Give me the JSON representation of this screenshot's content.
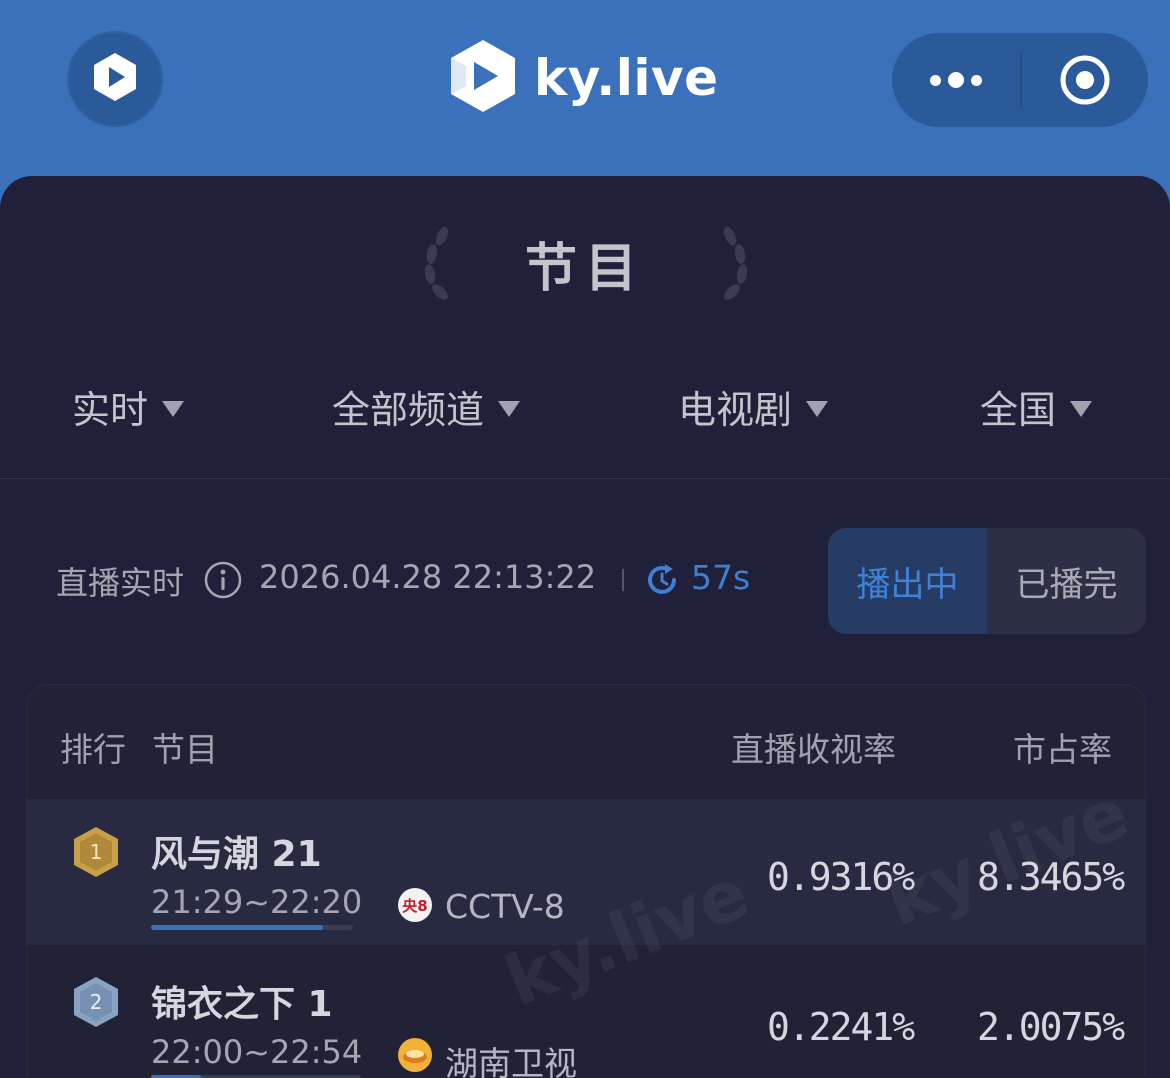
{
  "header": {
    "brand": "ky.live",
    "app_icon": "kylive-logo-icon",
    "more_icon": "more-dots-icon",
    "close_icon": "target-circle-icon",
    "colors": {
      "bar": "#3a71ba",
      "capsule": "#2b5a9a"
    }
  },
  "page": {
    "title": "节目",
    "background": "#20203a"
  },
  "filters": [
    {
      "label": "实时"
    },
    {
      "label": "全部频道"
    },
    {
      "label": "电视剧"
    },
    {
      "label": "全国"
    }
  ],
  "status": {
    "live_label": "直播实时",
    "timestamp": "2026.04.28 22:13:22",
    "countdown": "57s",
    "segments": {
      "active": "播出中",
      "inactive": "已播完"
    },
    "accent": "#3f7fd2"
  },
  "table": {
    "headers": {
      "rank": "排行",
      "program": "节目",
      "rating": "直播收视率",
      "share": "市占率"
    },
    "rows": [
      {
        "rank": "1",
        "name": "风与潮 21",
        "time": "21:29~22:20",
        "channel": "CCTV-8",
        "channel_badge": "央8",
        "rating": "0.9316%",
        "share": "8.3465%",
        "progress": 0.85
      },
      {
        "rank": "2",
        "name": "锦衣之下 1",
        "time": "22:00~22:54",
        "channel": "湖南卫视",
        "channel_badge": "",
        "rating": "0.2241%",
        "share": "2.0075%",
        "progress": 0.24
      }
    ]
  },
  "watermark": "ky.live"
}
